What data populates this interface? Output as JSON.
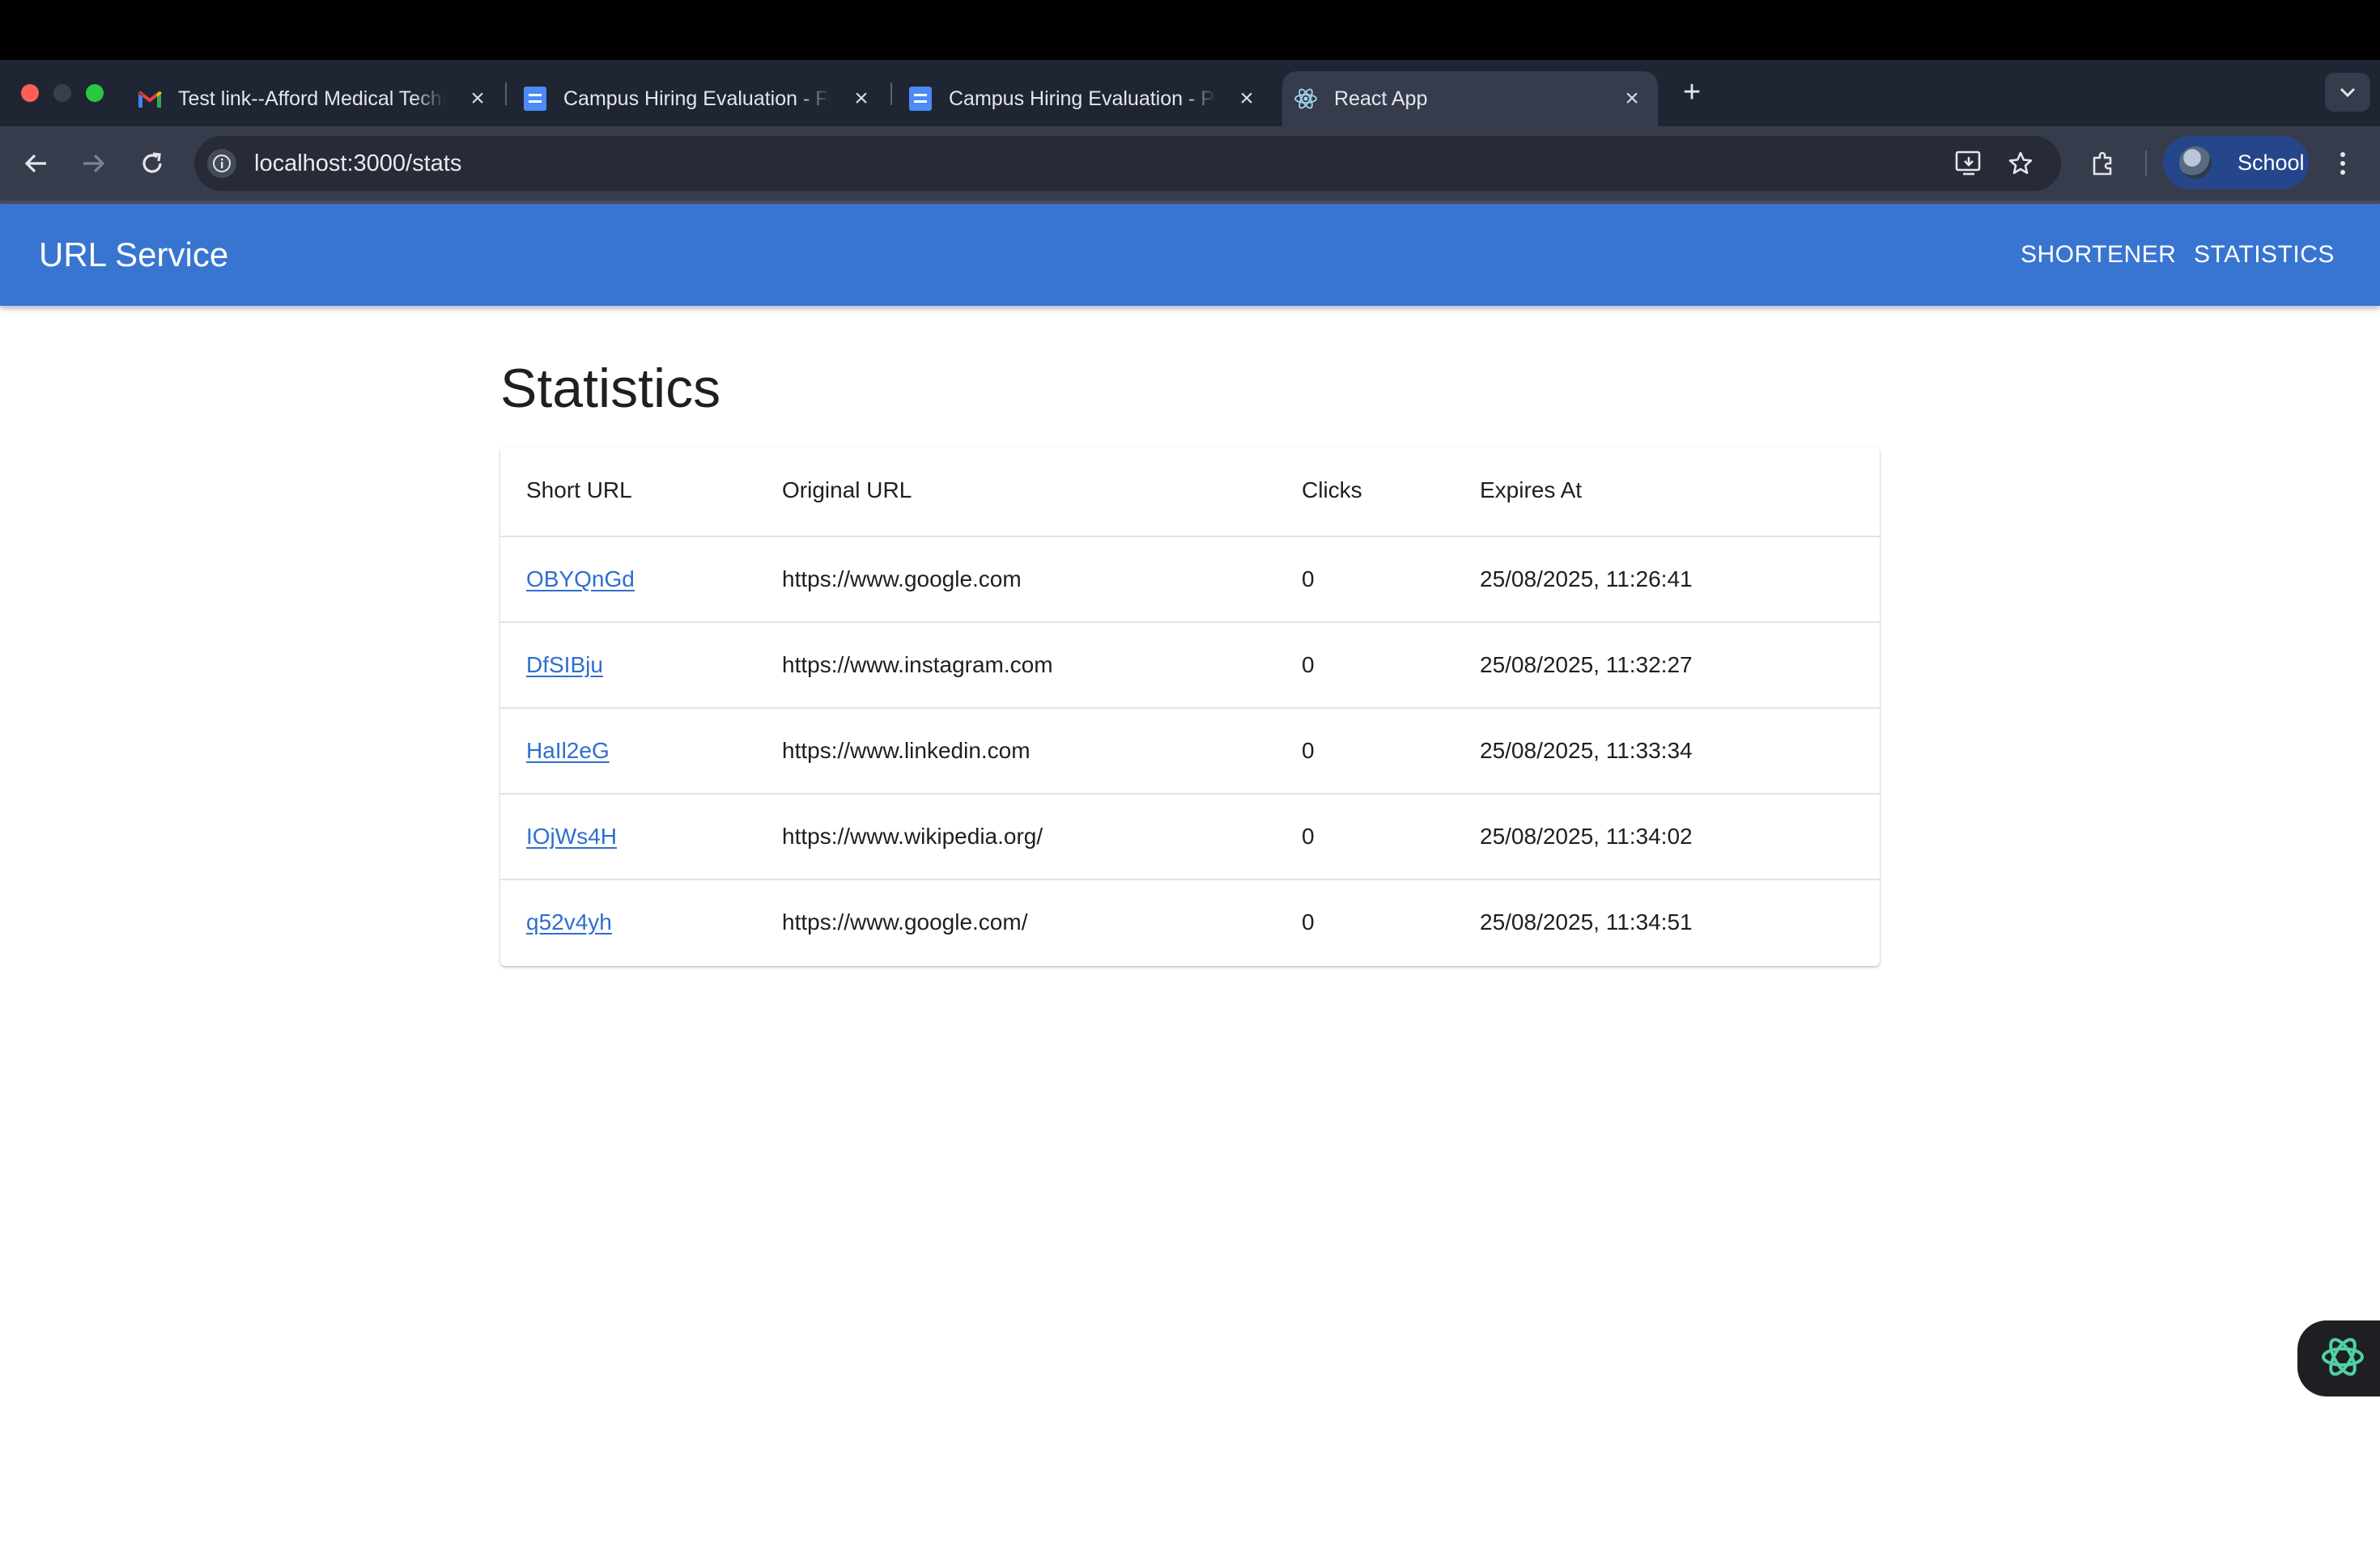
{
  "browser": {
    "tabs": [
      {
        "title": "Test link--Afford Medical Technologies",
        "icon": "gmail-icon"
      },
      {
        "title": "Campus Hiring Evaluation - Frontend",
        "icon": "google-docs-icon"
      },
      {
        "title": "Campus Hiring Evaluation - Pre-Test",
        "icon": "google-docs-icon"
      },
      {
        "title": "React App",
        "icon": "react-icon"
      }
    ],
    "url": "localhost:3000/stats",
    "profile_name": "School"
  },
  "app": {
    "brand": "URL Service",
    "nav": {
      "shortener": "SHORTENER",
      "statistics": "STATISTICS"
    },
    "page_title": "Statistics",
    "accent_color": "#3875d0",
    "link_color": "#2f6ed0"
  },
  "table": {
    "headers": [
      "Short URL",
      "Original URL",
      "Clicks",
      "Expires At"
    ],
    "rows": [
      {
        "short": "OBYQnGd",
        "original": "https://www.google.com",
        "clicks": "0",
        "expires": "25/08/2025, 11:26:41"
      },
      {
        "short": "DfSIBju",
        "original": "https://www.instagram.com",
        "clicks": "0",
        "expires": "25/08/2025, 11:32:27"
      },
      {
        "short": "HaIl2eG",
        "original": "https://www.linkedin.com",
        "clicks": "0",
        "expires": "25/08/2025, 11:33:34"
      },
      {
        "short": "IOjWs4H",
        "original": "https://www.wikipedia.org/",
        "clicks": "0",
        "expires": "25/08/2025, 11:34:02"
      },
      {
        "short": "q52v4yh",
        "original": "https://www.google.com/",
        "clicks": "0",
        "expires": "25/08/2025, 11:34:51"
      }
    ]
  }
}
